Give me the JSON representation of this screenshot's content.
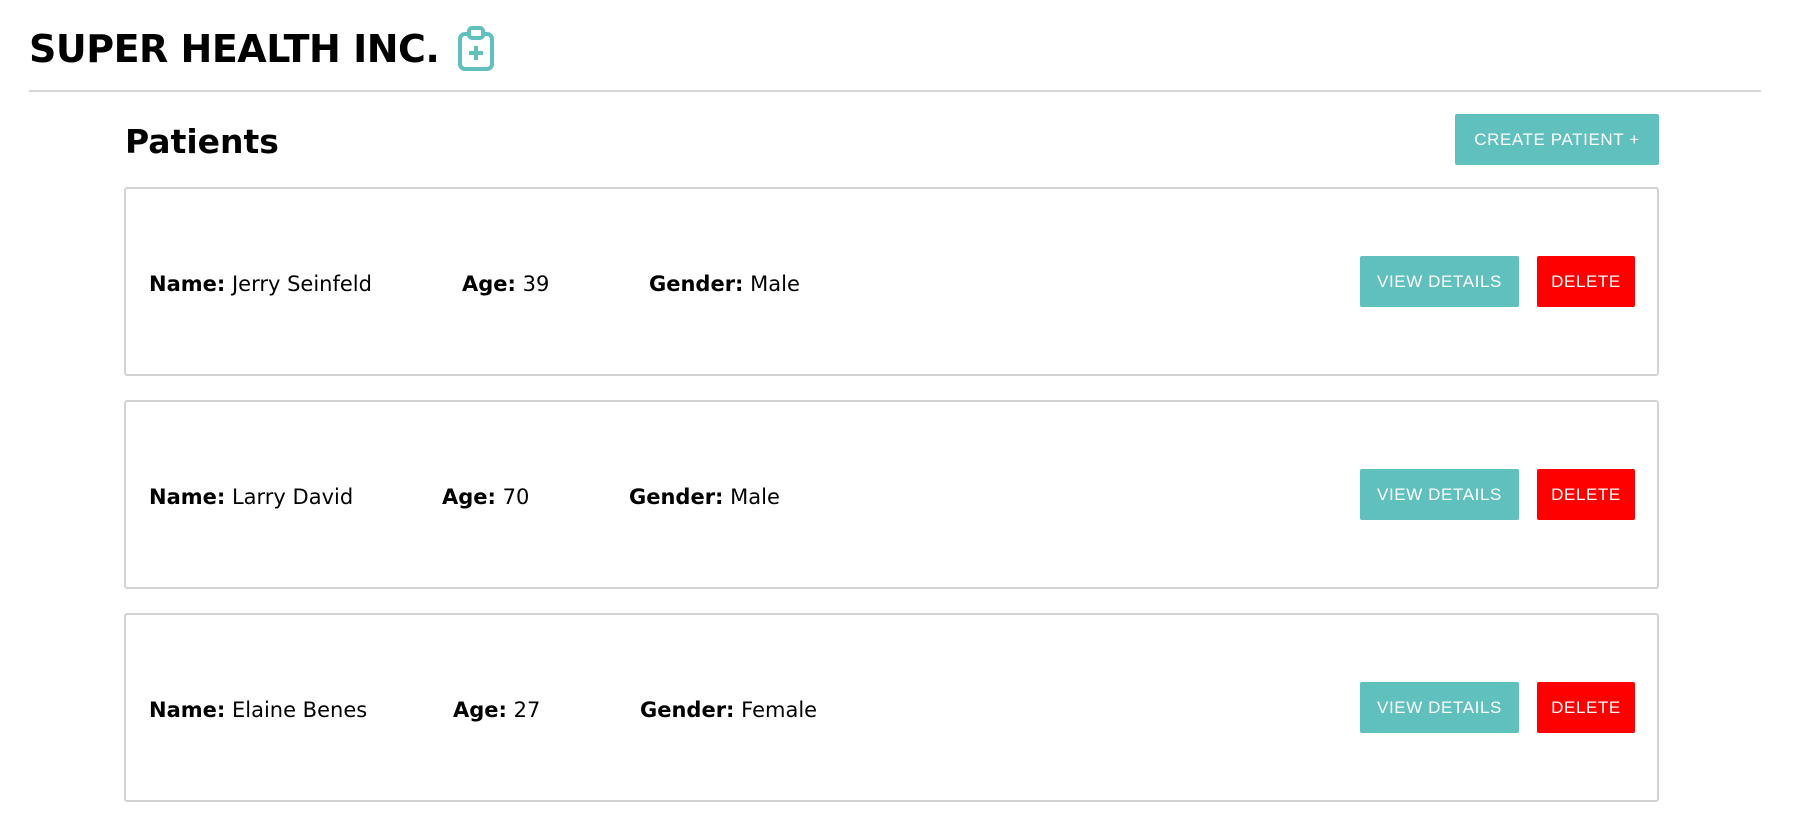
{
  "header": {
    "title": "SUPER HEALTH INC.",
    "icon": "clipboard-plus-icon",
    "accent_color": "#5fc0bd"
  },
  "page": {
    "title": "Patients",
    "create_button_label": "CREATE PATIENT +"
  },
  "labels": {
    "name": "Name:",
    "age": "Age:",
    "gender": "Gender:"
  },
  "patients": [
    {
      "name": "Jerry Seinfeld",
      "age": "39",
      "gender": "Male"
    },
    {
      "name": "Larry David",
      "age": "70",
      "gender": "Male"
    },
    {
      "name": "Elaine Benes",
      "age": "27",
      "gender": "Female"
    }
  ],
  "actions": {
    "view_label": "VIEW DETAILS",
    "delete_label": "DELETE"
  },
  "colors": {
    "primary": "#5fc0bd",
    "danger": "#ff0000",
    "border": "#d3d3d3"
  }
}
